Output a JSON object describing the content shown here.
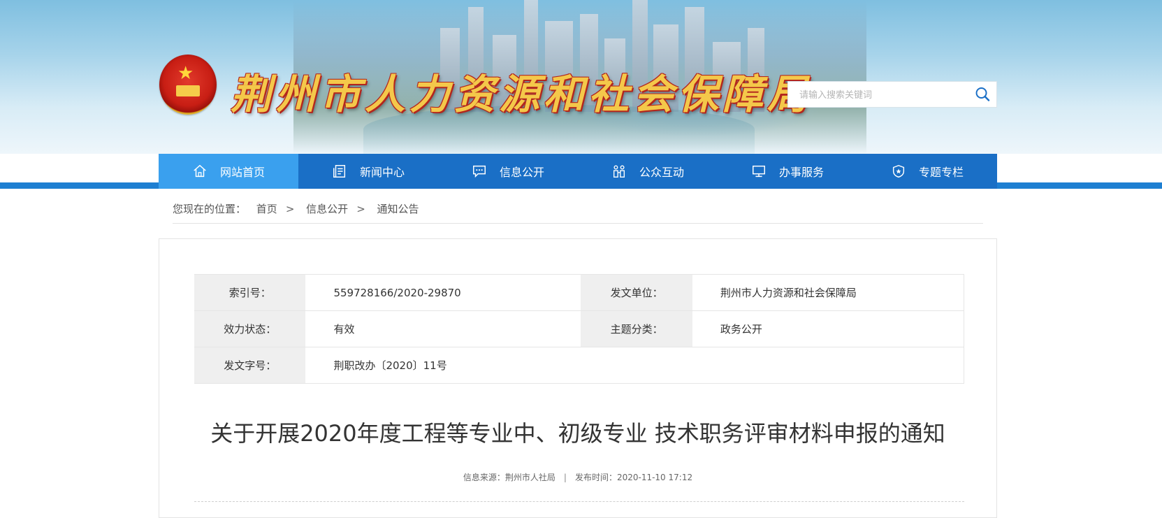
{
  "header": {
    "site_title": "荆州市人力资源和社会保障局",
    "search": {
      "placeholder": "请输入搜索关键词"
    }
  },
  "nav": [
    {
      "label": "网站首页",
      "icon": "home-icon",
      "active": true
    },
    {
      "label": "新闻中心",
      "icon": "news-icon",
      "active": false
    },
    {
      "label": "信息公开",
      "icon": "chat-icon",
      "active": false
    },
    {
      "label": "公众互动",
      "icon": "people-icon",
      "active": false
    },
    {
      "label": "办事服务",
      "icon": "monitor-icon",
      "active": false
    },
    {
      "label": "专题专栏",
      "icon": "shield-star-icon",
      "active": false
    }
  ],
  "breadcrumb": {
    "prefix": "您现在的位置：",
    "items": [
      "首页",
      "信息公开",
      "通知公告"
    ],
    "separator": ">"
  },
  "meta": {
    "index_label": "索引号：",
    "index_value": "559728166/2020-29870",
    "issuer_label": "发文单位：",
    "issuer_value": "荆州市人力资源和社会保障局",
    "status_label": "效力状态：",
    "status_value": "有效",
    "category_label": "主题分类：",
    "category_value": "政务公开",
    "docno_label": "发文字号：",
    "docno_value": "荆职改办〔2020〕11号"
  },
  "article": {
    "title": "关于开展2020年度工程等专业中、初级专业 技术职务评审材料申报的通知",
    "source": "信息来源：荆州市人社局",
    "divider": "|",
    "published": "发布时间：2020-11-10 17:12"
  },
  "colors": {
    "nav_bg": "#1a6fc6",
    "nav_active": "#3aa0ee",
    "title_gold": "#f4c84a",
    "title_outline": "#b3261e"
  }
}
